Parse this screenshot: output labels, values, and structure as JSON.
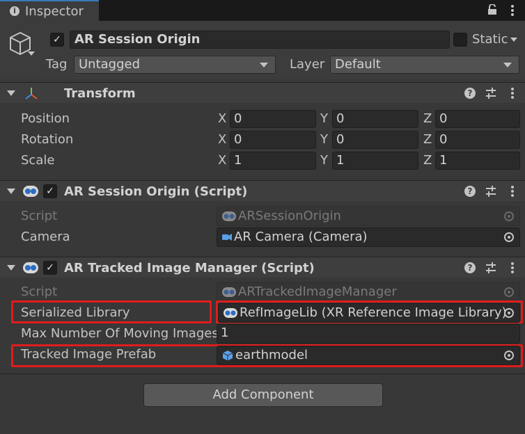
{
  "tab": {
    "label": "Inspector",
    "info_icon": "i"
  },
  "header": {
    "object_name": "AR Session Origin",
    "static_label": "Static",
    "tag_label": "Tag",
    "tag_value": "Untagged",
    "layer_label": "Layer",
    "layer_value": "Default"
  },
  "transform": {
    "title": "Transform",
    "rows": [
      {
        "label": "Position",
        "x": "0",
        "y": "0",
        "z": "0"
      },
      {
        "label": "Rotation",
        "x": "0",
        "y": "0",
        "z": "0"
      },
      {
        "label": "Scale",
        "x": "1",
        "y": "1",
        "z": "1"
      }
    ],
    "axes": {
      "x": "X",
      "y": "Y",
      "z": "Z"
    }
  },
  "session_origin": {
    "title": "AR Session Origin (Script)",
    "script_label": "Script",
    "script_value": "ARSessionOrigin",
    "camera_label": "Camera",
    "camera_value": "AR Camera (Camera)"
  },
  "tracked_image": {
    "title": "AR Tracked Image Manager (Script)",
    "script_label": "Script",
    "script_value": "ARTrackedImageManager",
    "library_label": "Serialized Library",
    "library_value": "RefImageLib (XR Reference Image Library)",
    "max_label": "Max Number Of Moving Images",
    "max_value": "1",
    "prefab_label": "Tracked Image Prefab",
    "prefab_value": "earthmodel"
  },
  "add_component": "Add Component",
  "icons": {
    "help": "?",
    "check": "✓"
  },
  "colors": {
    "highlight": "#e01c1c",
    "tab_accent": "#3a79bb"
  }
}
